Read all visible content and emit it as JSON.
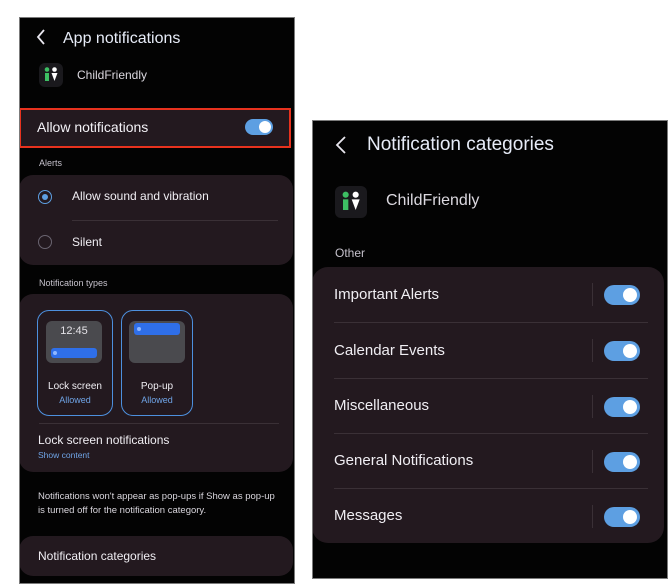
{
  "left": {
    "header_title": "App notifications",
    "app_name": "ChildFriendly",
    "allow_notifications": {
      "label": "Allow notifications",
      "enabled": true
    },
    "alerts": {
      "section_label": "Alerts",
      "options": [
        {
          "label": "Allow sound and vibration",
          "selected": true
        },
        {
          "label": "Silent",
          "selected": false
        }
      ]
    },
    "notification_types": {
      "section_label": "Notification types",
      "preview_time": "12:45",
      "items": [
        {
          "label": "Lock screen",
          "status": "Allowed"
        },
        {
          "label": "Pop-up",
          "status": "Allowed"
        }
      ]
    },
    "lock_screen_notifications": {
      "label": "Lock screen notifications",
      "value": "Show content"
    },
    "info_text": "Notifications won't appear as pop-ups if Show as pop-up is turned off for the notification category.",
    "categories_link": "Notification categories"
  },
  "right": {
    "header_title": "Notification categories",
    "app_name": "ChildFriendly",
    "section_label": "Other",
    "categories": [
      {
        "label": "Important Alerts",
        "enabled": true
      },
      {
        "label": "Calendar Events",
        "enabled": true
      },
      {
        "label": "Miscellaneous",
        "enabled": true
      },
      {
        "label": "General Notifications",
        "enabled": true
      },
      {
        "label": "Messages",
        "enabled": true
      }
    ]
  },
  "colors": {
    "accent": "#5d9fe2",
    "highlight_border": "#e8321e",
    "card": "#23191f",
    "background": "#030303"
  },
  "icons": {
    "back": "chevron-left-icon",
    "app": "childfriendly-app-icon"
  }
}
